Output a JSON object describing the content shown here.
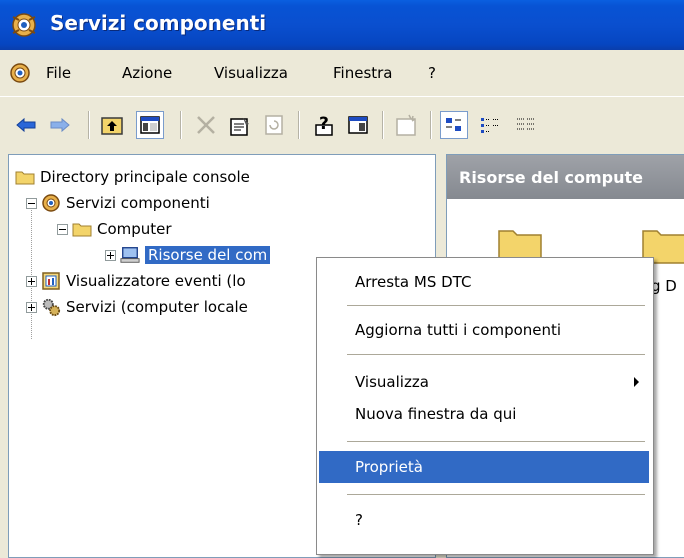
{
  "window": {
    "title": "Servizi componenti"
  },
  "menubar": {
    "items": [
      "File",
      "Azione",
      "Visualizza",
      "Finestra",
      "?"
    ]
  },
  "toolbar": {
    "buttons": [
      "back-icon",
      "forward-icon",
      "up-folder-icon",
      "show-hide-tree-icon",
      "delete-icon",
      "properties-icon",
      "refresh-icon",
      "help-icon",
      "action-pane-icon",
      "new-window-icon",
      "large-icons-view-icon",
      "small-icons-view-icon",
      "list-view-icon"
    ]
  },
  "tree": {
    "root": "Directory principale console",
    "items": [
      {
        "label": "Servizi componenti",
        "icon": "component-services-icon"
      },
      {
        "label": "Computer",
        "icon": "folder-icon"
      },
      {
        "label": "Risorse del com",
        "icon": "computer-icon",
        "selected": true
      },
      {
        "label": "Visualizzatore eventi (lo",
        "icon": "event-viewer-icon"
      },
      {
        "label": "Servizi (computer locale",
        "icon": "services-icon"
      }
    ]
  },
  "right_pane": {
    "header": "Risorse del compute",
    "items": [
      "g D"
    ]
  },
  "context_menu": {
    "items": [
      {
        "label": "Arresta MS DTC"
      },
      {
        "label": "Aggiorna tutti i componenti"
      },
      {
        "label": "Visualizza",
        "submenu": true
      },
      {
        "label": "Nuova finestra da qui"
      },
      {
        "label": "Proprietà",
        "highlighted": true
      },
      {
        "label": "?"
      }
    ]
  },
  "colors": {
    "title_bar": "#0a4fcf",
    "selection": "#316ac5",
    "menu_bg": "#ece9d8"
  }
}
